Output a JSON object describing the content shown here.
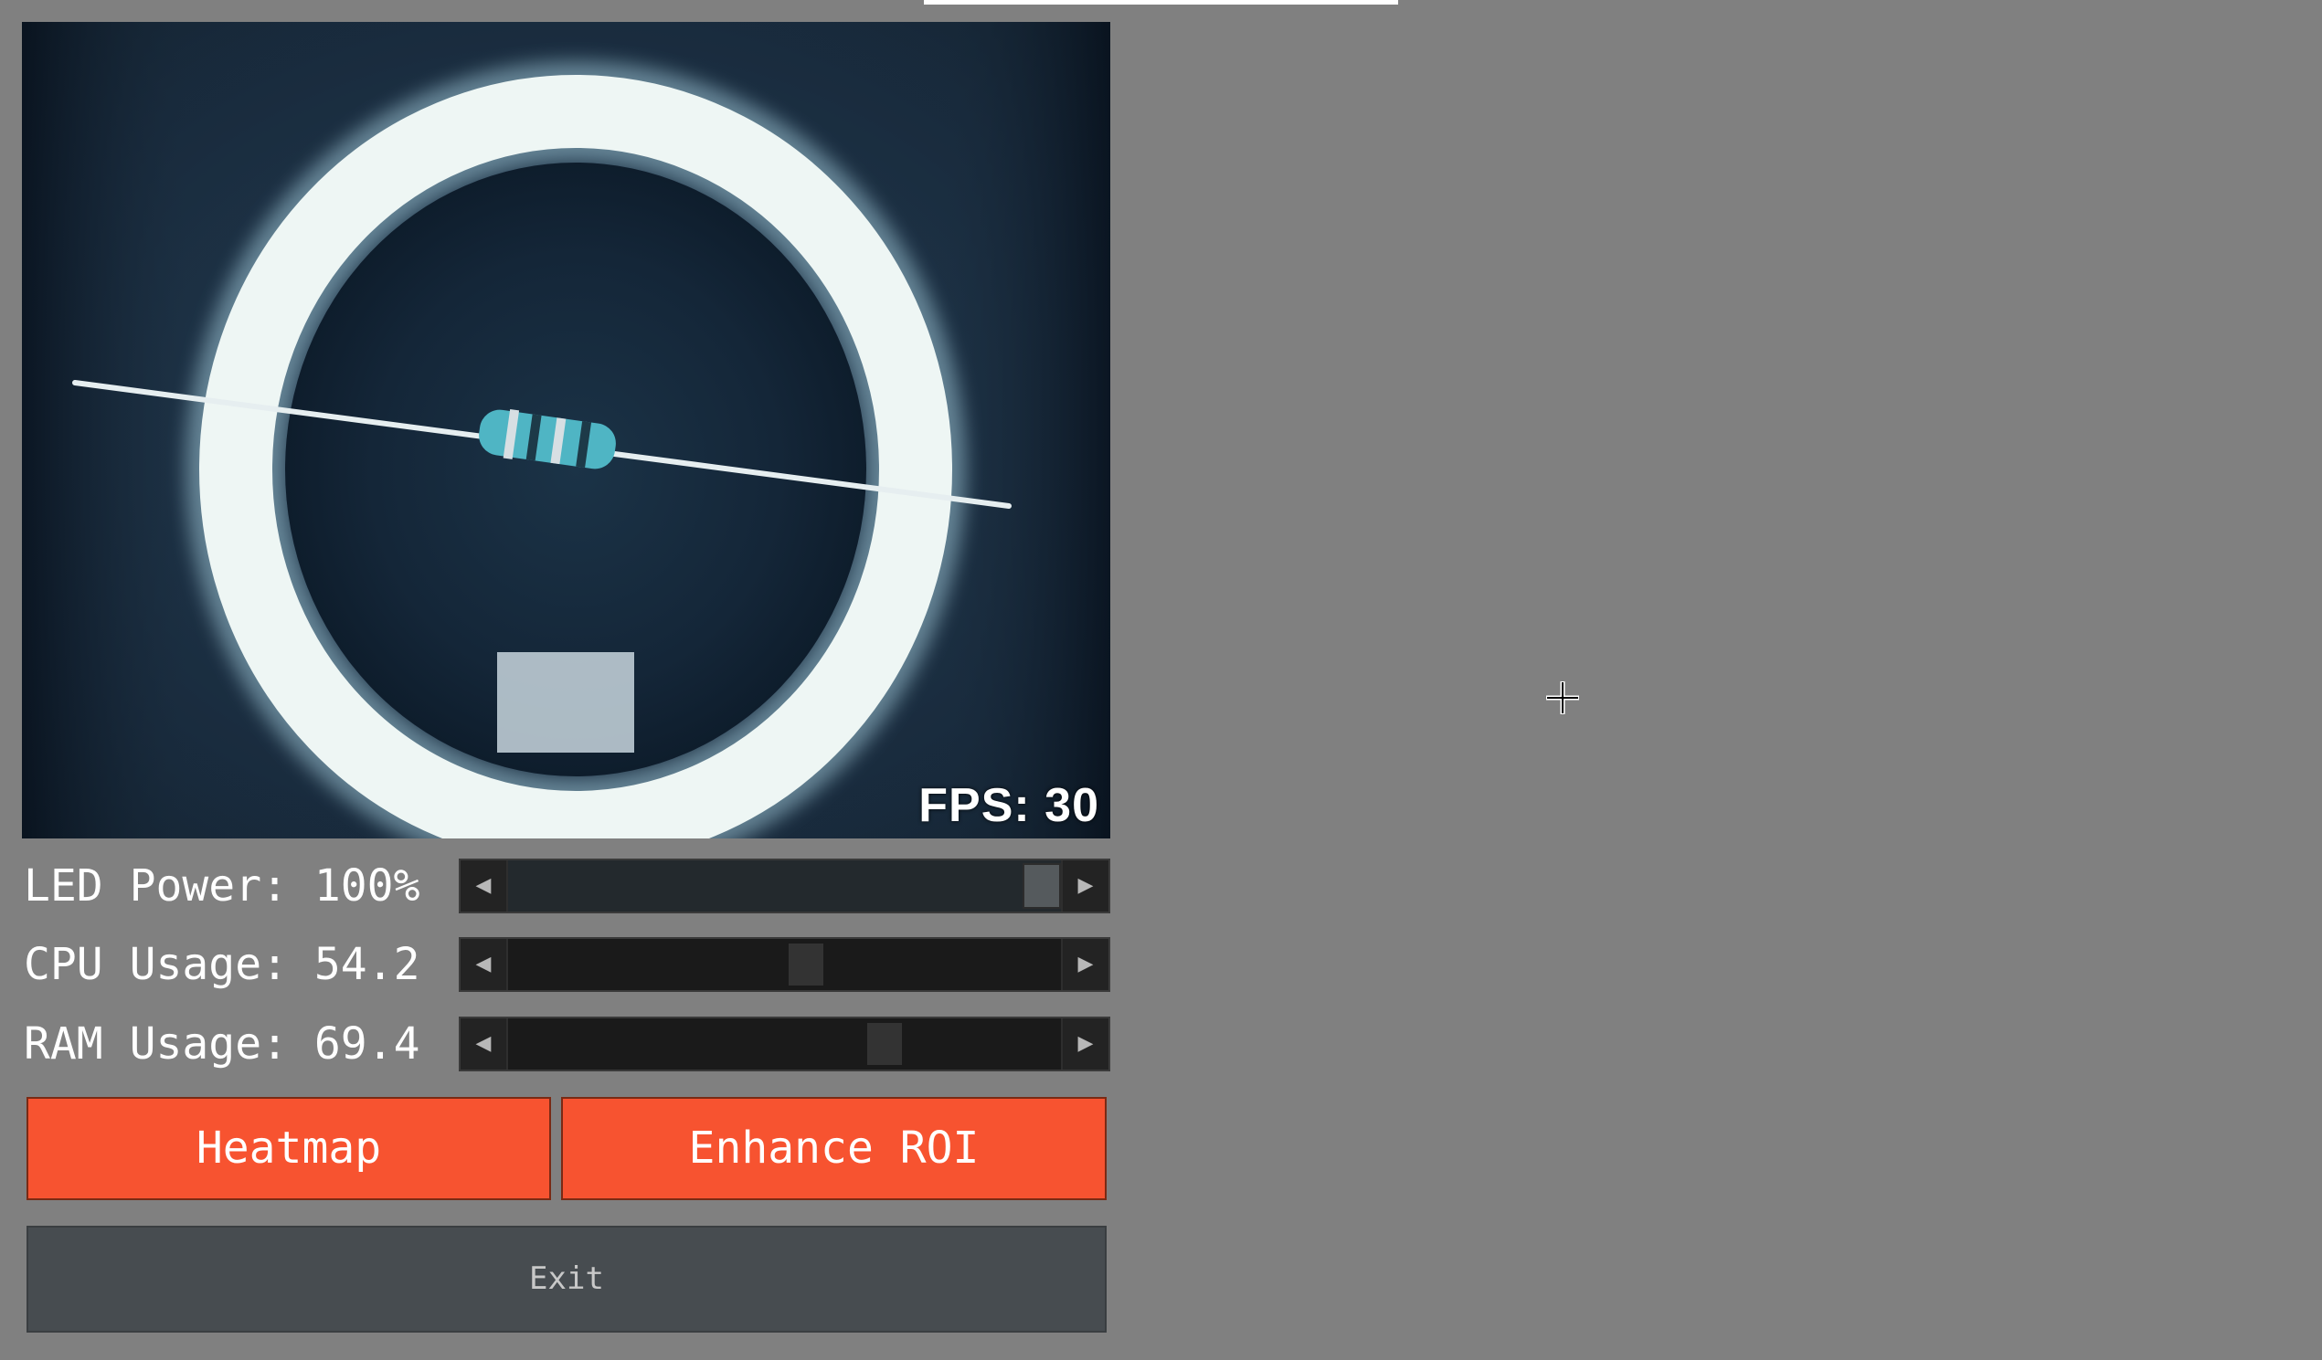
{
  "camera": {
    "fps_text": "FPS: 30"
  },
  "controls": {
    "led": {
      "label": "LED Power: 100%",
      "value": 100
    },
    "cpu": {
      "label": "CPU Usage: 54.2",
      "value": 54.2
    },
    "ram": {
      "label": "RAM Usage: 69.4",
      "value": 69.4
    },
    "slider_left_glyph": "◀",
    "slider_right_glyph": "▶"
  },
  "buttons": {
    "heatmap": "Heatmap",
    "enhance_roi": "Enhance ROI",
    "exit": "Exit"
  },
  "colors": {
    "background": "#808080",
    "accent_button": "#f75330",
    "exit_button": "#474c50"
  },
  "icons": {
    "cursor": "crosshair-icon"
  }
}
